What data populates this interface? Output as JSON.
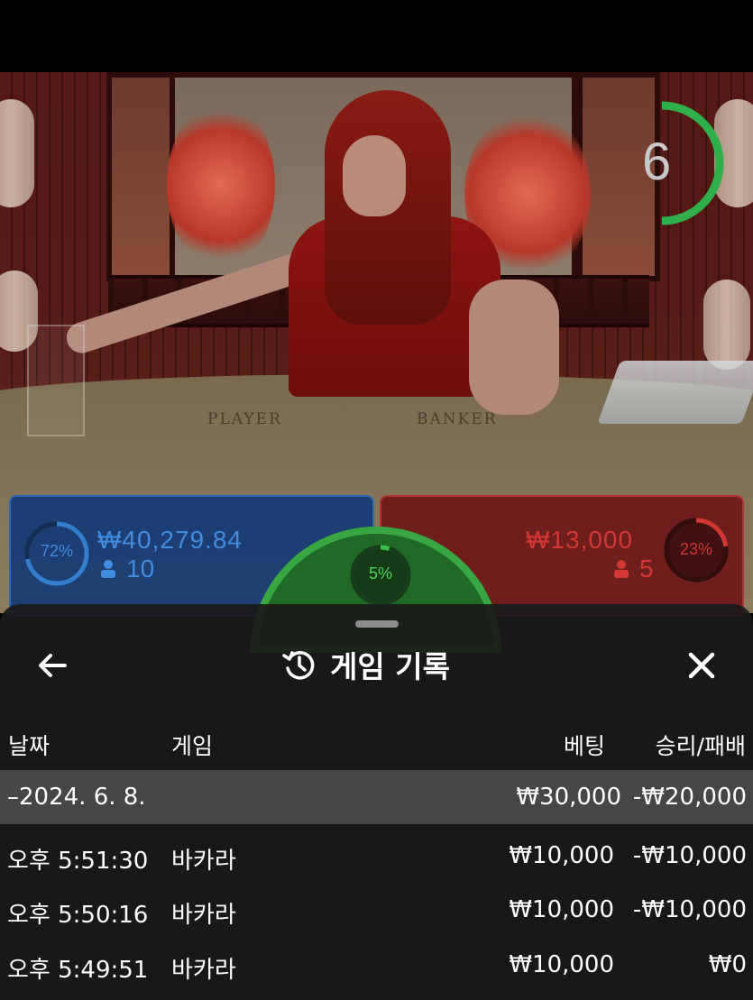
{
  "video": {
    "table_labels": {
      "player": "PLAYER",
      "banker": "BANKER"
    },
    "timer": {
      "value": "6",
      "fraction_remaining": 0.5,
      "color": "#2fb04a"
    }
  },
  "bets": {
    "player": {
      "amount": "₩40,279.84",
      "count": "10",
      "percent": "72%",
      "percent_value": 0.72,
      "color": "#2e7fd6"
    },
    "banker": {
      "amount": "₩13,000",
      "count": "5",
      "percent": "23%",
      "percent_value": 0.23,
      "color": "#d83434"
    },
    "tie": {
      "percent": "5%",
      "percent_value": 0.05,
      "color": "#39c049"
    }
  },
  "history": {
    "title": "게임 기록",
    "back_icon": "arrow-left-icon",
    "title_icon": "history-clock-icon",
    "close_icon": "close-x-icon",
    "columns": {
      "date": "날짜",
      "game": "게임",
      "bet": "베팅",
      "result": "승리/패배"
    },
    "date_group": {
      "label": "–2024. 6. 8.",
      "bet": "₩30,000",
      "result": "-₩20,000"
    },
    "rows": [
      {
        "time": "오후 5:51:30",
        "game": "바카라",
        "bet": "₩10,000",
        "result": "-₩10,000"
      },
      {
        "time": "오후 5:50:16",
        "game": "바카라",
        "bet": "₩10,000",
        "result": "-₩10,000"
      },
      {
        "time": "오후 5:49:51",
        "game": "바카라",
        "bet": "₩10,000",
        "result": "₩0"
      }
    ]
  }
}
